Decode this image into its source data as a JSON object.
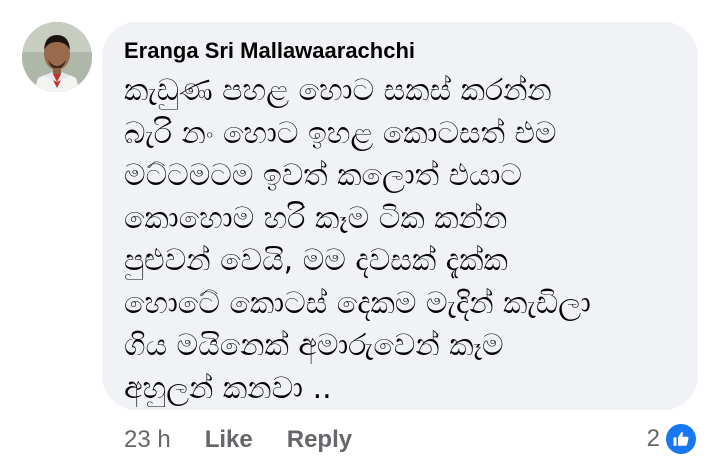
{
  "comment": {
    "author": "Eranga Sri Mallawaarachchi",
    "avatar": "profile-photo",
    "lines": [
      "කැඩුණ පහළ හොට සකස් කරන්න",
      "බැරි නං හොට ඉහළ කොටසත් එම",
      "මට්ටමටම ඉවත් කලොත් එයාට",
      "කොහොම හරි කෑම ටික කන්න",
      "පුළුවන් වෙයි, මම දවසක් දැක්ක",
      "හොටේ කොටස් දෙකම මැදින් කැඩිලා",
      "ගිය මයිනෙක් අමාරුවෙන් කෑම",
      "අහුලන් කනවා .."
    ]
  },
  "actions": {
    "time": "23 h",
    "like_label": "Like",
    "reply_label": "Reply"
  },
  "reactions": {
    "count": "2",
    "icon": "like-icon"
  },
  "colors": {
    "bubble": "#f0f2f5",
    "text": "#050505",
    "secondary": "#65676b",
    "like_blue": "#1877f2"
  }
}
